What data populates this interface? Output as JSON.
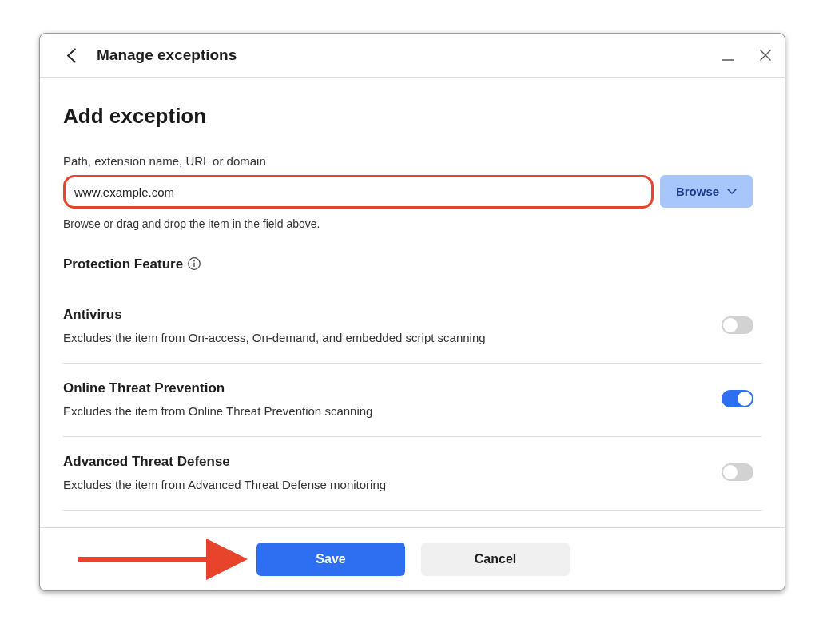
{
  "window": {
    "title": "Manage exceptions"
  },
  "form": {
    "heading": "Add exception",
    "field": {
      "label": "Path, extension name, URL or domain",
      "value": "www.example.com",
      "highlighted": true
    },
    "browse_button": "Browse",
    "hint": "Browse or drag and drop the item in the field above."
  },
  "features": {
    "heading": "Protection Feature",
    "items": [
      {
        "name": "Antivirus",
        "description": "Excludes the item from On-access, On-demand, and embedded script scanning",
        "on": false
      },
      {
        "name": "Online Threat Prevention",
        "description": "Excludes the item from Online Threat Prevention scanning",
        "on": true
      },
      {
        "name": "Advanced Threat Defense",
        "description": "Excludes the item from Advanced Threat Defense monitoring",
        "on": false
      }
    ]
  },
  "buttons": [
    {
      "label": "Save",
      "kind": "primary"
    },
    {
      "label": "Cancel",
      "kind": "secondary"
    }
  ]
}
